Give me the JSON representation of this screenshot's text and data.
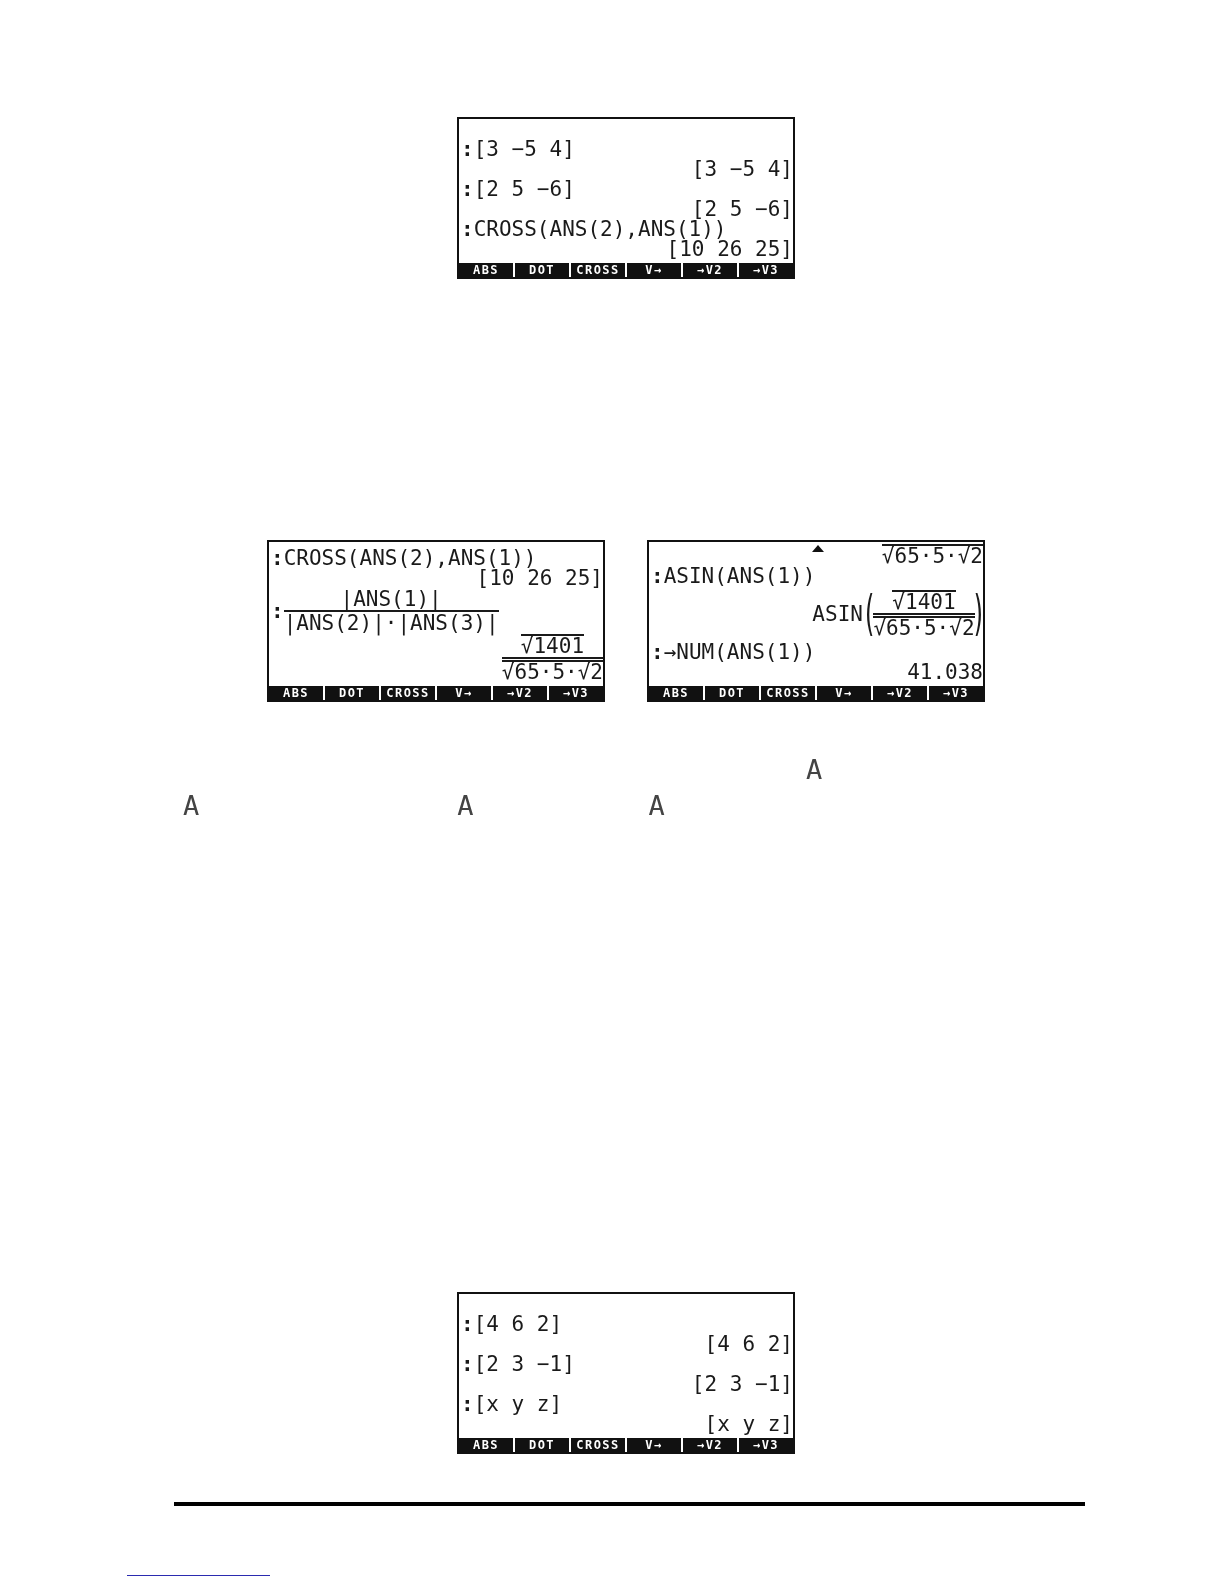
{
  "figure_1": {
    "screens": [
      {
        "more_above": false,
        "lines": [
          {
            "kind": "input",
            "prompt": ":",
            "text": "[3 −5 4]"
          },
          {
            "kind": "result",
            "text": "[3 −5 4]"
          },
          {
            "kind": "input",
            "prompt": ":",
            "text": "[2 5 −6]"
          },
          {
            "kind": "result",
            "text": "[2 5 −6]"
          },
          {
            "kind": "input",
            "prompt": ":",
            "text": "CROSS(ANS(2),ANS(1))"
          },
          {
            "kind": "result",
            "text": "[10 26 25]"
          }
        ],
        "menu": [
          "ABS",
          "DOT",
          "CROSS",
          "V→",
          "→V2",
          "→V3"
        ]
      }
    ]
  },
  "figure_2": {
    "screens": [
      {
        "more_above": false,
        "lines": [
          {
            "kind": "input",
            "prompt": ":",
            "text": "CROSS(ANS(2),ANS(1))"
          },
          {
            "kind": "result",
            "text": "[10 26 25]"
          },
          {
            "kind": "input_fraction",
            "prompt": ":",
            "numerator": "|ANS(1)|",
            "denominator": "|ANS(2)|·|ANS(3)|"
          },
          {
            "kind": "result_fraction",
            "numerator": "√1401",
            "denominator": "√65·5·√2"
          }
        ],
        "menu": [
          "ABS",
          "DOT",
          "CROSS",
          "V→",
          "→V2",
          "→V3"
        ]
      },
      {
        "more_above": true,
        "lines": [
          {
            "kind": "radical_result",
            "text": "√65·5·√2"
          },
          {
            "kind": "input",
            "prompt": ":",
            "text": "ASIN(ANS(1))"
          },
          {
            "kind": "function_result",
            "function": "ASIN",
            "open": "(",
            "numerator": "√1401",
            "denominator": "√65·5·√2",
            "close": ")"
          },
          {
            "kind": "input",
            "prompt": ":",
            "text": "→NUM(ANS(1))"
          },
          {
            "kind": "result",
            "text": "41.038"
          }
        ],
        "menu": [
          "ABS",
          "DOT",
          "CROSS",
          "V→",
          "→V2",
          "→V3"
        ]
      }
    ]
  },
  "alpha_key_symbols": [
    "A",
    "A",
    "A",
    "A"
  ],
  "figure_3": {
    "screens": [
      {
        "more_above": false,
        "lines": [
          {
            "kind": "input",
            "prompt": ":",
            "text": "[4 6 2]"
          },
          {
            "kind": "result",
            "text": "[4 6 2]"
          },
          {
            "kind": "input",
            "prompt": ":",
            "text": "[2 3 −1]"
          },
          {
            "kind": "result",
            "text": "[2 3 −1]"
          },
          {
            "kind": "input",
            "prompt": ":",
            "text": "[x y z]"
          },
          {
            "kind": "result",
            "text": "[x y z]"
          }
        ],
        "menu": [
          "ABS",
          "DOT",
          "CROSS",
          "V→",
          "→V2",
          "→V3"
        ]
      }
    ]
  }
}
